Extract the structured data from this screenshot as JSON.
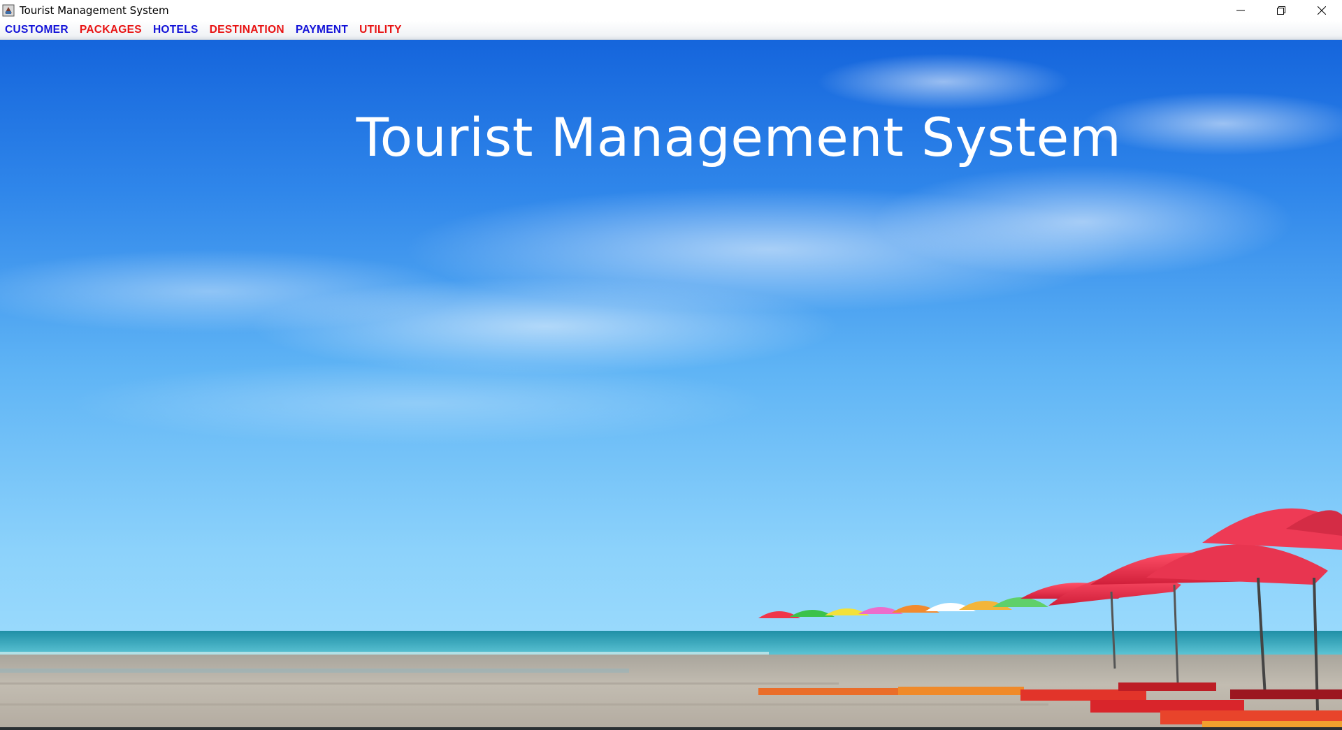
{
  "window": {
    "title": "Tourist Management System",
    "icon": "java-app-icon",
    "controls": [
      "minimize-icon",
      "restore-icon",
      "close-icon"
    ]
  },
  "menu": {
    "items": [
      {
        "label": "CUSTOMER",
        "color": "#1212d8"
      },
      {
        "label": "PACKAGES",
        "color": "#e81313"
      },
      {
        "label": "HOTELS",
        "color": "#1212d8"
      },
      {
        "label": "DESTINATION",
        "color": "#e81313"
      },
      {
        "label": "PAYMENT",
        "color": "#1212d8"
      },
      {
        "label": "UTILITY",
        "color": "#e81313"
      }
    ]
  },
  "hero": {
    "title": "Tourist Management System",
    "background": "beach-with-umbrellas-photo"
  },
  "colors": {
    "sky_top": "#1e6fe0",
    "sky_bottom": "#8fd3fb",
    "sea": "#2a9bb0",
    "sand": "#b9b2a6",
    "umbrella": "#e8304a"
  }
}
